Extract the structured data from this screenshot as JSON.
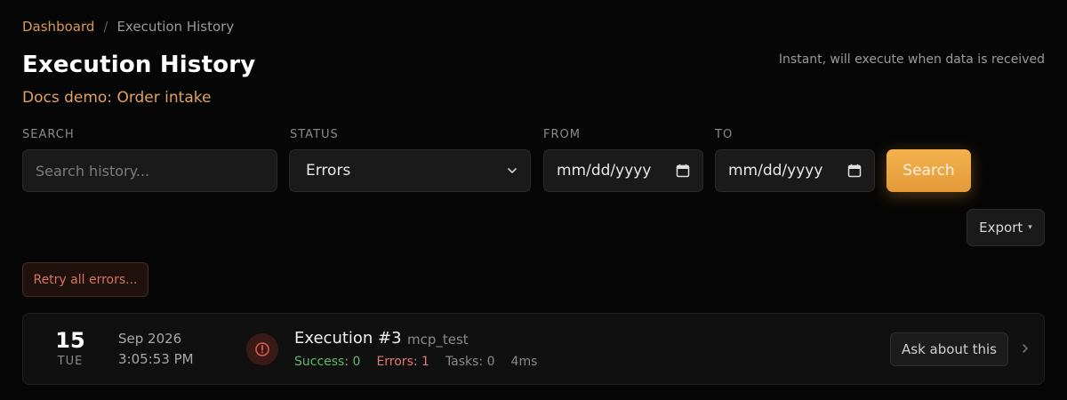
{
  "breadcrumb": {
    "parent": "Dashboard",
    "separator": "/",
    "current": "Execution History"
  },
  "header": {
    "title": "Execution History",
    "workflow_name": "Docs demo: Order intake",
    "trigger_note": "Instant, will execute when data is received"
  },
  "filters": {
    "search": {
      "label": "SEARCH",
      "placeholder": "Search history...",
      "value": ""
    },
    "status": {
      "label": "STATUS",
      "selected": "Errors"
    },
    "from": {
      "label": "FROM",
      "value": "mm/dd/yyyy"
    },
    "to": {
      "label": "TO",
      "value": "mm/dd/yyyy"
    },
    "search_button": "Search"
  },
  "actions": {
    "export_label": "Export",
    "retry_label": "Retry all errors..."
  },
  "executions": [
    {
      "day": "15",
      "weekday": "TUE",
      "month_year": "Sep 2026",
      "time": "3:05:53 PM",
      "status": "error",
      "title": "Execution #3",
      "tag": "mcp_test",
      "success": "Success: 0",
      "errors": "Errors: 1",
      "tasks": "Tasks: 0",
      "duration": "4ms",
      "ask_label": "Ask about this"
    }
  ],
  "icons": {
    "status_icon": "alert-circle-icon",
    "select_chevron": "chevron-down-icon",
    "calendar": "calendar-icon",
    "row_chevron": "chevron-right-icon"
  },
  "colors": {
    "accent": "#e59a3a",
    "link": "#d99a52",
    "error": "#e07a6c",
    "success": "#5fb96a",
    "background": "#060606"
  }
}
